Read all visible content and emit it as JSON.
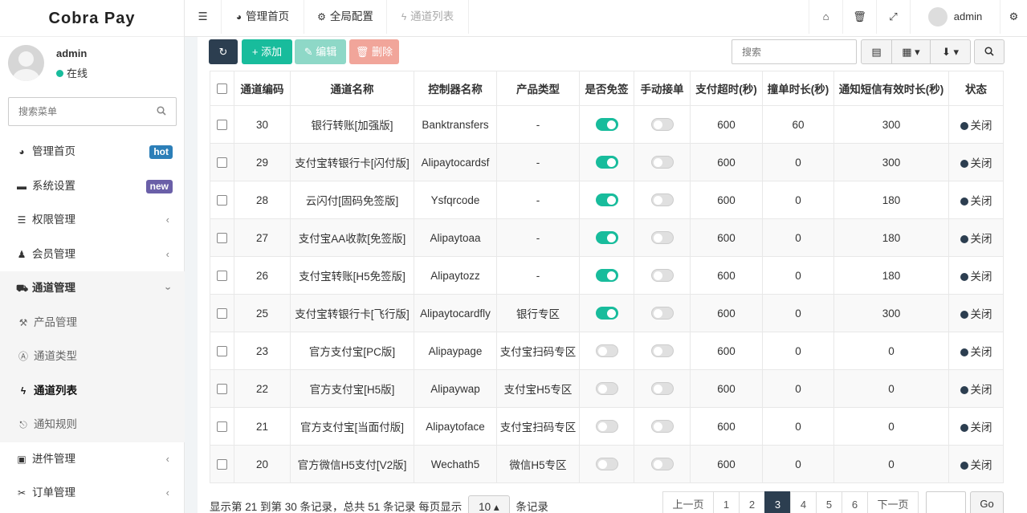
{
  "app": {
    "brand": "Cobra Pay"
  },
  "user": {
    "name": "admin",
    "status": "在线"
  },
  "sidebar": {
    "search_placeholder": "搜索菜单",
    "items": [
      {
        "label": "管理首页",
        "icon": "dashboard-icon",
        "badge": "hot"
      },
      {
        "label": "系统设置",
        "icon": "folder-icon",
        "badge": "new"
      },
      {
        "label": "权限管理",
        "icon": "list-icon",
        "arrow": "‹"
      },
      {
        "label": "会员管理",
        "icon": "user-plus-icon",
        "arrow": "‹"
      },
      {
        "label": "通道管理",
        "icon": "cart-icon",
        "arrow": "›"
      },
      {
        "label": "产品管理",
        "icon": "product-icon"
      },
      {
        "label": "通道类型",
        "icon": "type-icon"
      },
      {
        "label": "通道列表",
        "icon": "bolt-icon"
      },
      {
        "label": "通知规则",
        "icon": "rule-icon"
      },
      {
        "label": "进件管理",
        "icon": "archive-icon",
        "arrow": "‹"
      },
      {
        "label": "订单管理",
        "icon": "scissors-icon",
        "arrow": "‹"
      }
    ]
  },
  "topbar": {
    "tabs": [
      {
        "label": "管理首页",
        "icon": "dashboard-icon"
      },
      {
        "label": "全局配置",
        "icon": "cogs-icon"
      },
      {
        "label": "通道列表",
        "icon": "bolt-icon"
      }
    ],
    "user_label": "admin"
  },
  "toolbar": {
    "add_label": "添加",
    "edit_label": "编辑",
    "delete_label": "删除",
    "search_placeholder": "搜索"
  },
  "table": {
    "headers": [
      "通道编码",
      "通道名称",
      "控制器名称",
      "产品类型",
      "是否免签",
      "手动接单",
      "支付超时(秒)",
      "撞单时长(秒)",
      "通知短信有效时长(秒)",
      "状态"
    ],
    "rows": [
      {
        "code": "30",
        "name": "银行转账[加强版]",
        "controller": "Banktransfers",
        "product": "-",
        "free_sign": true,
        "manual": false,
        "timeout": "600",
        "collide": "60",
        "sms": "300",
        "status": "关闭"
      },
      {
        "code": "29",
        "name": "支付宝转银行卡[闪付版]",
        "controller": "Alipaytocardsf",
        "product": "-",
        "free_sign": true,
        "manual": false,
        "timeout": "600",
        "collide": "0",
        "sms": "300",
        "status": "关闭"
      },
      {
        "code": "28",
        "name": "云闪付[固码免签版]",
        "controller": "Ysfqrcode",
        "product": "-",
        "free_sign": true,
        "manual": false,
        "timeout": "600",
        "collide": "0",
        "sms": "180",
        "status": "关闭"
      },
      {
        "code": "27",
        "name": "支付宝AA收款[免签版]",
        "controller": "Alipaytoaa",
        "product": "-",
        "free_sign": true,
        "manual": false,
        "timeout": "600",
        "collide": "0",
        "sms": "180",
        "status": "关闭"
      },
      {
        "code": "26",
        "name": "支付宝转账[H5免签版]",
        "controller": "Alipaytozz",
        "product": "-",
        "free_sign": true,
        "manual": false,
        "timeout": "600",
        "collide": "0",
        "sms": "180",
        "status": "关闭"
      },
      {
        "code": "25",
        "name": "支付宝转银行卡[飞行版]",
        "controller": "Alipaytocardfly",
        "product": "银行专区",
        "free_sign": true,
        "manual": false,
        "timeout": "600",
        "collide": "0",
        "sms": "300",
        "status": "关闭"
      },
      {
        "code": "23",
        "name": "官方支付宝[PC版]",
        "controller": "Alipaypage",
        "product": "支付宝扫码专区",
        "free_sign": false,
        "manual": false,
        "timeout": "600",
        "collide": "0",
        "sms": "0",
        "status": "关闭"
      },
      {
        "code": "22",
        "name": "官方支付宝[H5版]",
        "controller": "Alipaywap",
        "product": "支付宝H5专区",
        "free_sign": false,
        "manual": false,
        "timeout": "600",
        "collide": "0",
        "sms": "0",
        "status": "关闭"
      },
      {
        "code": "21",
        "name": "官方支付宝[当面付版]",
        "controller": "Alipaytoface",
        "product": "支付宝扫码专区",
        "free_sign": false,
        "manual": false,
        "timeout": "600",
        "collide": "0",
        "sms": "0",
        "status": "关闭"
      },
      {
        "code": "20",
        "name": "官方微信H5支付[V2版]",
        "controller": "Wechath5",
        "product": "微信H5专区",
        "free_sign": false,
        "manual": false,
        "timeout": "600",
        "collide": "0",
        "sms": "0",
        "status": "关闭"
      }
    ]
  },
  "footer": {
    "info_prefix": "显示第 21 到第 30 条记录，总共 51 条记录 每页显示",
    "page_size": "10",
    "info_suffix": "条记录",
    "pages": [
      "上一页",
      "1",
      "2",
      "3",
      "4",
      "5",
      "6",
      "下一页"
    ],
    "current_page": "3",
    "go_label": "Go"
  },
  "colors": {
    "accent": "#18bc9c",
    "dark": "#2c3e50"
  }
}
